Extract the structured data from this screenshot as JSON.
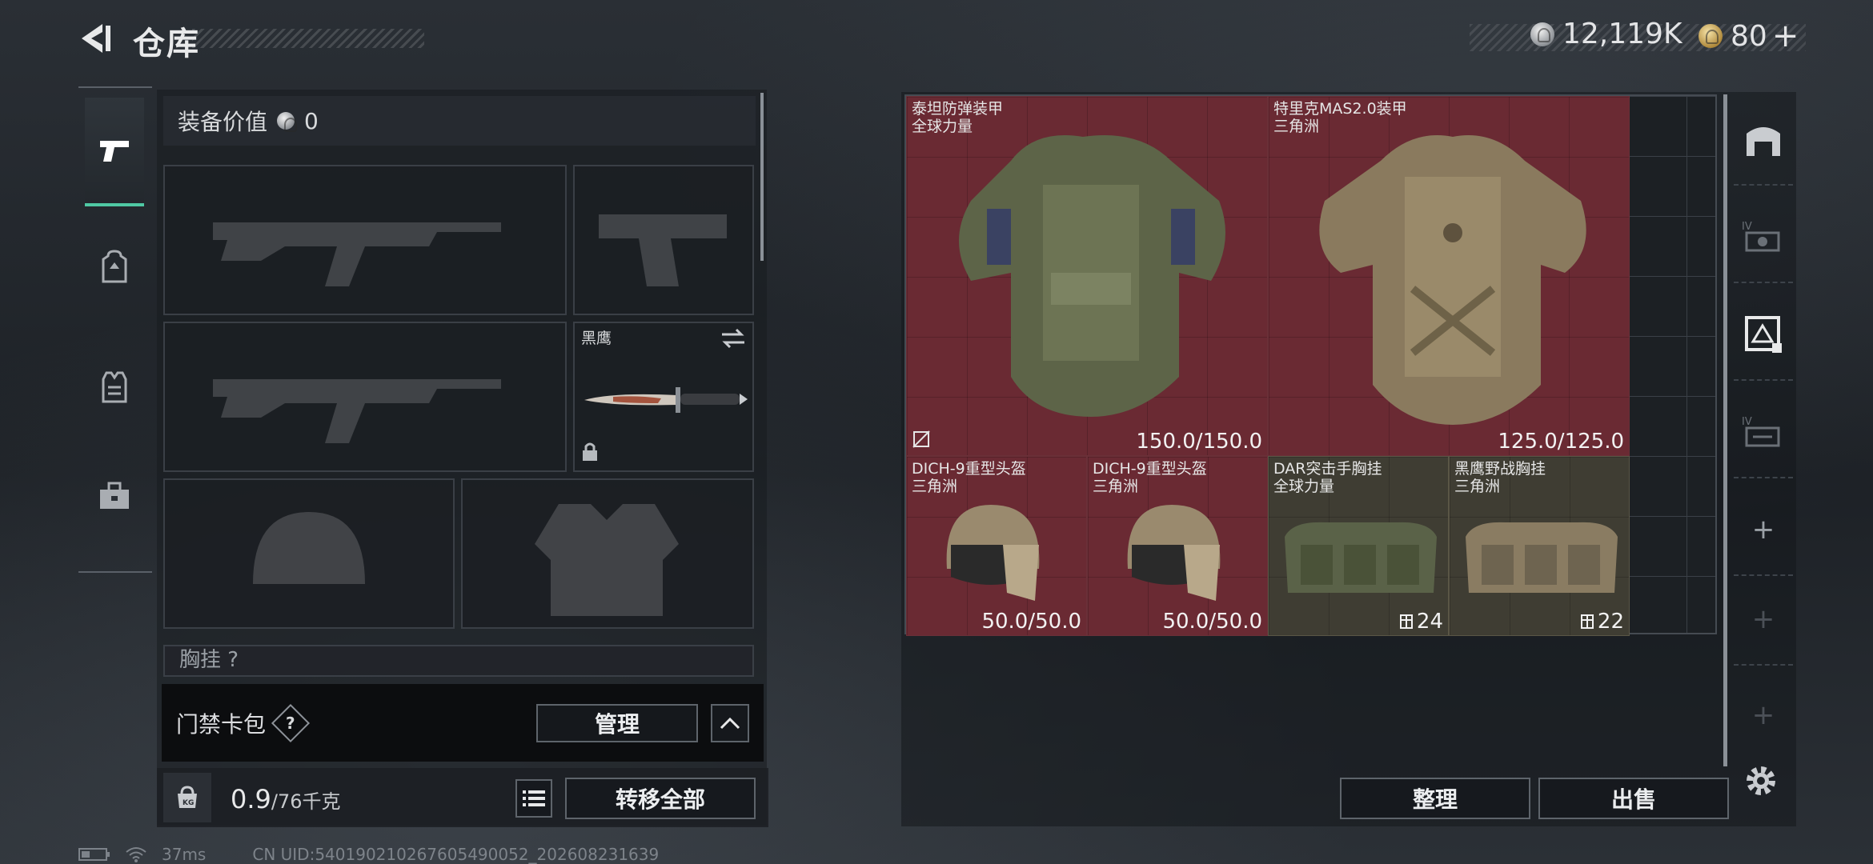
{
  "header": {
    "title": "仓库",
    "currency_silver": "12,119K",
    "currency_gold": "80",
    "gold_plus": "+"
  },
  "left_tabs": [
    "weapon-tab",
    "backpack-tab",
    "armor-tab",
    "toolbox-tab"
  ],
  "loadout": {
    "equip_value_label": "装备价值",
    "equip_value": "0",
    "knife_name": "黑鹰",
    "chest_peek_label": "胸挂",
    "chest_peek_count": "?",
    "access_card_label": "门禁卡包",
    "access_card_help": "?",
    "manage_label": "管理",
    "weight_value": "0.9",
    "weight_max": "/76千克",
    "transfer_all_label": "转移全部"
  },
  "stash": {
    "items": [
      {
        "name": "泰坦防弹装甲",
        "sub": "全球力量",
        "value": "150.0/150.0"
      },
      {
        "name": "特里克MAS2.0装甲",
        "sub": "三角洲",
        "value": "125.0/125.0"
      },
      {
        "name": "DICH-9重型头盔",
        "sub": "三角洲",
        "value": "50.0/50.0"
      },
      {
        "name": "DICH-9重型头盔",
        "sub": "三角洲",
        "value": "50.0/50.0"
      },
      {
        "name": "DAR突击手胸挂",
        "sub": "全球力量",
        "value": "24"
      },
      {
        "name": "黑鹰野战胸挂",
        "sub": "三角洲",
        "value": "22"
      }
    ],
    "sort_label": "整理",
    "sell_label": "出售"
  },
  "right_icons": [
    "warehouse-icon",
    "tier-IV-gear-icon",
    "tier-IV-card-icon",
    "tier-IV-case-icon",
    "add-icon",
    "add-icon",
    "add-icon",
    "settings-icon"
  ],
  "status": {
    "ping": "37ms",
    "uid": "CN UID:540190210267605490052_202608231639"
  },
  "colors": {
    "accent": "#4fc9a4",
    "item_red": "#6a2a33",
    "item_olive": "#3f3d33"
  }
}
